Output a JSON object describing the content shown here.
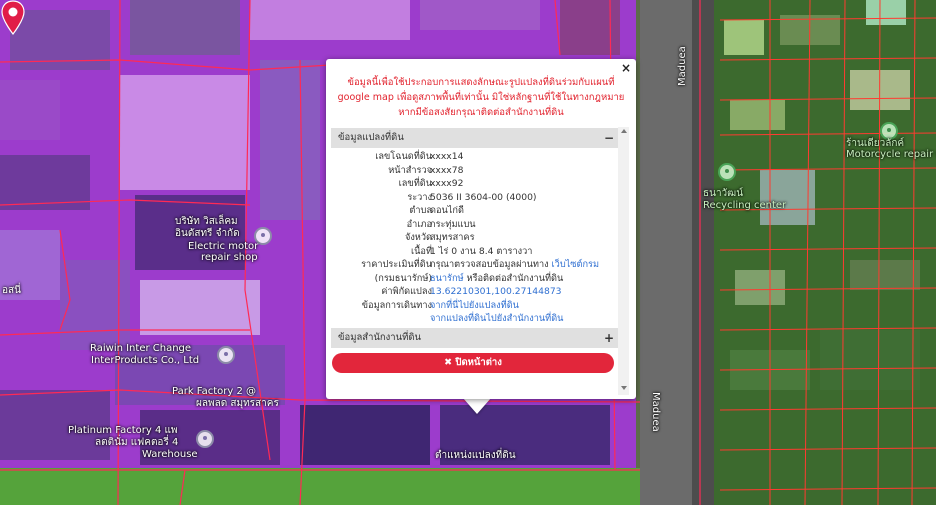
{
  "map": {
    "labels": [
      {
        "id": "road-maduea-top",
        "text": "Maduea"
      },
      {
        "id": "road-maduea-bottom",
        "text": "Maduea"
      },
      {
        "id": "motorcycle-th",
        "text": "ร้านเดียวลักค์"
      },
      {
        "id": "motorcycle-en",
        "text": "Motorcycle repair shop"
      },
      {
        "id": "recycling-th",
        "text": "ธนาวัฒน์"
      },
      {
        "id": "recycling-en",
        "text": "Recycling center"
      },
      {
        "id": "electric-th-1",
        "text": "บริษัท วิสเล็คม"
      },
      {
        "id": "electric-th-2",
        "text": "อินดัสทรี จำกัด"
      },
      {
        "id": "electric-en-1",
        "text": "Electric motor"
      },
      {
        "id": "electric-en-2",
        "text": "repair shop"
      },
      {
        "id": "raiwin-1",
        "text": "Raiwin Inter Change"
      },
      {
        "id": "raiwin-2",
        "text": "InterProducts Co., Ltd"
      },
      {
        "id": "park-1",
        "text": "Park Factory 2 @"
      },
      {
        "id": "park-2",
        "text": "ผลพลด สมุทรสาคร"
      },
      {
        "id": "platinum-1",
        "text": "Platinum Factory 4 แพ"
      },
      {
        "id": "platinum-2",
        "text": "ลตตินั่ม แฟคตอรี่ 4"
      },
      {
        "id": "platinum-3",
        "text": "Warehouse"
      },
      {
        "id": "left-th",
        "text": "อสนี่"
      },
      {
        "id": "marker-label",
        "text": "ตำแหน่งแปลงที่ดิน"
      }
    ]
  },
  "popup": {
    "close_icon": "×",
    "disclaimer": "ข้อมูลนี้เพื่อใช้ประกอบการแสดงลักษณะรูปแปลงที่ดินร่วมกับแผนที่ google map เพื่อดูสภาพพื้นที่เท่านั้น มิใช่หลักฐานที่ใช้ในทางกฎหมาย หากมีข้อสงสัยกรุณาติดต่อสำนักงานที่ดิน",
    "section1": {
      "title": "ข้อมูลแปลงที่ดิน",
      "toggle": "−"
    },
    "rows": [
      {
        "k": "เลขโฉนดที่ดิน",
        "v": "xxxx14"
      },
      {
        "k": "หน้าสำรวจ",
        "v": "xxxx78"
      },
      {
        "k": "เลขที่ดิน",
        "v": "xxxx92"
      },
      {
        "k": "ระวาง",
        "v": "5036 II 3604-00 (4000)"
      },
      {
        "k": "ตำบล",
        "v": "ดอนไก่ดี"
      },
      {
        "k": "อำเภอ",
        "v": "กระทุ่มแบน"
      },
      {
        "k": "จังหวัด",
        "v": "สมุทรสาคร"
      },
      {
        "k": "เนื้อที่",
        "v": "1 ไร่ 0 งาน 8.4 ตารางวา"
      },
      {
        "k": "ราคาประเมินที่ดิน",
        "v": "กรุณาตรวจสอบข้อมูลผ่านทาง ",
        "link": "เว็บไซต์กรม"
      },
      {
        "k": "(กรมธนารักษ์)",
        "v": "",
        "link": "ธนารักษ์",
        "v2": " หรือติดต่อสำนักงานที่ดิน"
      },
      {
        "k": "ค่าพิกัดแปลง",
        "v": "",
        "link": "13.62210301,100.27144873"
      },
      {
        "k": "ข้อมูลการเดินทาง",
        "v": "",
        "link": "จากที่นี่ไปยังแปลงที่ดิน"
      },
      {
        "k": "",
        "v": "",
        "link": "จากแปลงที่ดินไปยังสำนักงานที่ดิน"
      }
    ],
    "section2": {
      "title": "ข้อมูลสำนักงานที่ดิน",
      "toggle": "+"
    },
    "close_button": "✖ ปิดหน้าต่าง"
  },
  "colors": {
    "accent_red": "#e2263b",
    "disclaimer_red": "#e2232e",
    "link_blue": "#2f6fd1",
    "parcel_overlay": "#b02fd8",
    "parcel_line": "#ff2a55"
  }
}
